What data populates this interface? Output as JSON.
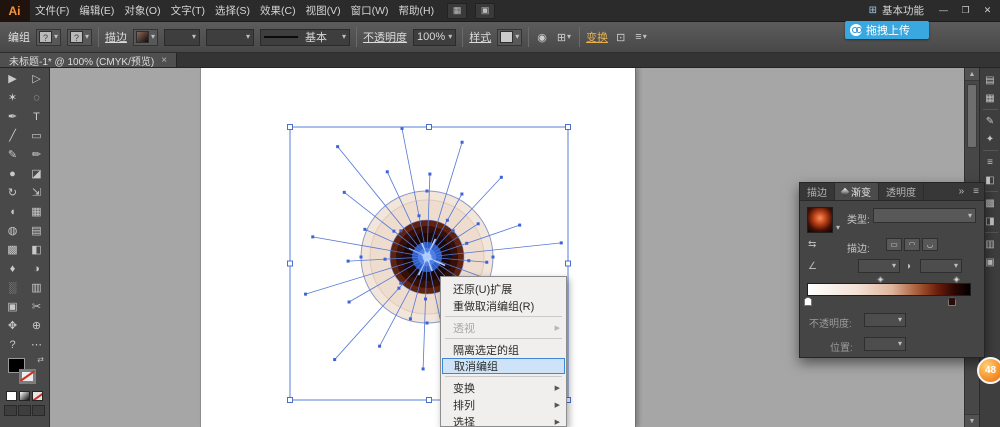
{
  "icons": {
    "dropdown": "▾",
    "submenu_arrow": "▶",
    "scroll_up": "▲",
    "scroll_down": "▼",
    "panel_collapse": "»",
    "panel_menu": "≡",
    "arrange_documents": "▦",
    "layout_switch": "▣",
    "workspace_grid": "⊞",
    "recolor_artwork": "◉",
    "align": "⊞",
    "isolate": "⊡",
    "menu_lines": "≡",
    "swap_swatch": "⇄",
    "reverse_gradient": "⇆",
    "angle": "∠",
    "aspect": "◗"
  },
  "titlebar": {
    "logo": "Ai",
    "menus": [
      {
        "name": "menu-file",
        "label": "文件(F)"
      },
      {
        "name": "menu-edit",
        "label": "编辑(E)"
      },
      {
        "name": "menu-object",
        "label": "对象(O)"
      },
      {
        "name": "menu-type",
        "label": "文字(T)"
      },
      {
        "name": "menu-select",
        "label": "选择(S)"
      },
      {
        "name": "menu-effect",
        "label": "效果(C)"
      },
      {
        "name": "menu-view",
        "label": "视图(V)"
      },
      {
        "name": "menu-window",
        "label": "窗口(W)"
      },
      {
        "name": "menu-help",
        "label": "帮助(H)"
      }
    ],
    "workspace": "基本功能",
    "minimize": "—",
    "restore": "❐",
    "close": "✕"
  },
  "upload": {
    "label": "拖拽上传"
  },
  "control_bar": {
    "context_label": "编组",
    "mixed_mark": "?",
    "stroke_label": "描边",
    "brush_style": "基本",
    "opacity_label": "不透明度",
    "opacity_value": "100%",
    "style_label": "样式",
    "transform_label": "变换"
  },
  "doc_tab": {
    "title": "未标题-1* @ 100% (CMYK/预览)",
    "close": "×"
  },
  "toolbar": {
    "tools": [
      {
        "name": "selection-tool",
        "glyph": "▶"
      },
      {
        "name": "direct-selection-tool",
        "glyph": "▷"
      },
      {
        "name": "magic-wand-tool",
        "glyph": "✶"
      },
      {
        "name": "lasso-tool",
        "glyph": "◌"
      },
      {
        "name": "pen-tool",
        "glyph": "✒"
      },
      {
        "name": "type-tool",
        "glyph": "T"
      },
      {
        "name": "line-segment-tool",
        "glyph": "╱"
      },
      {
        "name": "rectangle-tool",
        "glyph": "▭"
      },
      {
        "name": "paintbrush-tool",
        "glyph": "✎"
      },
      {
        "name": "pencil-tool",
        "glyph": "✏"
      },
      {
        "name": "blob-brush-tool",
        "glyph": "●"
      },
      {
        "name": "eraser-tool",
        "glyph": "◪"
      },
      {
        "name": "rotate-tool",
        "glyph": "↻"
      },
      {
        "name": "scale-tool",
        "glyph": "⇲"
      },
      {
        "name": "width-tool",
        "glyph": "◖"
      },
      {
        "name": "free-transform-tool",
        "glyph": "▦"
      },
      {
        "name": "shape-builder-tool",
        "glyph": "◍"
      },
      {
        "name": "perspective-grid-tool",
        "glyph": "▤"
      },
      {
        "name": "mesh-tool",
        "glyph": "▩"
      },
      {
        "name": "gradient-tool",
        "glyph": "◧"
      },
      {
        "name": "eyedropper-tool",
        "glyph": "♦"
      },
      {
        "name": "blend-tool",
        "glyph": "◑"
      },
      {
        "name": "symbol-sprayer-tool",
        "glyph": "░"
      },
      {
        "name": "column-graph-tool",
        "glyph": "▥"
      },
      {
        "name": "artboard-tool",
        "glyph": "▣"
      },
      {
        "name": "slice-tool",
        "glyph": "✂"
      },
      {
        "name": "hand-tool",
        "glyph": "✥"
      },
      {
        "name": "zoom-tool",
        "glyph": "⊕"
      },
      {
        "name": "help-tool",
        "glyph": "?"
      },
      {
        "name": "edit-toolbar-button",
        "glyph": "⋯"
      }
    ]
  },
  "context_menu": {
    "items": [
      {
        "name": "undo-expand",
        "label": "还原(U)扩展"
      },
      {
        "name": "redo-ungroup",
        "label": "重做取消编组(R)"
      },
      {
        "separator": true
      },
      {
        "name": "perspective",
        "label": "透视",
        "disabled": true,
        "submenu": true
      },
      {
        "separator": true
      },
      {
        "name": "isolate-selected-group",
        "label": "隔离选定的组"
      },
      {
        "name": "ungroup",
        "label": "取消编组",
        "highlighted": true
      },
      {
        "separator": true
      },
      {
        "name": "transform",
        "label": "变换",
        "submenu": true
      },
      {
        "name": "arrange",
        "label": "排列",
        "submenu": true
      },
      {
        "name": "select",
        "label": "选择",
        "submenu": true
      }
    ]
  },
  "gradient_panel": {
    "tabs": [
      {
        "name": "tab-stroke",
        "label": "描边"
      },
      {
        "name": "tab-gradient",
        "label": "渐变",
        "active": true
      },
      {
        "name": "tab-transparency",
        "label": "透明度"
      }
    ],
    "type_label": "类型:",
    "stroke_label": "描边:",
    "opacity_label": "不透明度:",
    "position_label": "位置:",
    "stroke_buttons": [
      "▭",
      "◠",
      "◡"
    ],
    "gradient_colors": [
      "#ffffff",
      "#e8c7b4",
      "#a65a34",
      "#5a1408",
      "#000000"
    ]
  },
  "dock": {
    "icons": [
      {
        "name": "color-panel-icon",
        "glyph": "▤"
      },
      {
        "name": "swatches-panel-icon",
        "glyph": "▦"
      },
      {
        "name": "brushes-panel-icon",
        "glyph": "✎"
      },
      {
        "name": "symbols-panel-icon",
        "glyph": "✦"
      },
      {
        "name": "stroke-panel-icon",
        "glyph": "≡"
      },
      {
        "name": "gradient-panel-icon",
        "glyph": "◧"
      },
      {
        "name": "transparency-panel-icon",
        "glyph": "▩"
      },
      {
        "name": "appearance-panel-icon",
        "glyph": "◨"
      },
      {
        "name": "layers-panel-icon",
        "glyph": "▥"
      },
      {
        "name": "graphic-styles-panel-icon",
        "glyph": "▣"
      }
    ]
  },
  "badge": {
    "value": "48"
  },
  "eye": {
    "outer": "#f2e5da",
    "rim": "#eedccf",
    "iris_dark": "#5f2312",
    "iris_deep": "#360f07",
    "pupil_ring": "#1c0704",
    "blue": "#2a5cc8",
    "blue_light": "#4e86ee",
    "blue_core": "#a9c9ff",
    "selection": "#5577d6"
  }
}
